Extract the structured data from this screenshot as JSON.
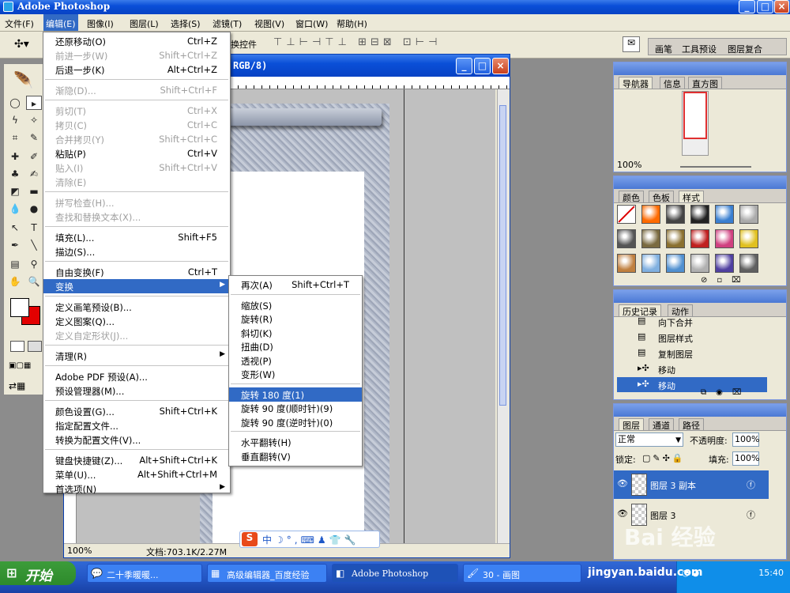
{
  "app": {
    "title": "Adobe Photoshop"
  },
  "menubar": [
    "文件(F)",
    "编辑(E)",
    "图像(I)",
    "图层(L)",
    "选择(S)",
    "滤镜(T)",
    "视图(V)",
    "窗口(W)",
    "帮助(H)"
  ],
  "toolbar": {
    "transform_controls": "换控件",
    "tabs": [
      "画笔",
      "工具预设",
      "图层复合"
    ]
  },
  "doc": {
    "title_suffix": "RGB/8)",
    "zoom": "100%",
    "status": "文档:703.1K/2.27M"
  },
  "edit_menu": [
    {
      "label": "还原移动(O)",
      "shortcut": "Ctrl+Z"
    },
    {
      "label": "前进一步(W)",
      "shortcut": "Shift+Ctrl+Z",
      "disabled": true
    },
    {
      "label": "后退一步(K)",
      "shortcut": "Alt+Ctrl+Z"
    },
    {
      "label": "渐隐(D)...",
      "shortcut": "Shift+Ctrl+F",
      "disabled": true
    },
    {
      "label": "剪切(T)",
      "shortcut": "Ctrl+X",
      "disabled": true
    },
    {
      "label": "拷贝(C)",
      "shortcut": "Ctrl+C",
      "disabled": true
    },
    {
      "label": "合并拷贝(Y)",
      "shortcut": "Shift+Ctrl+C",
      "disabled": true
    },
    {
      "label": "粘贴(P)",
      "shortcut": "Ctrl+V"
    },
    {
      "label": "贴入(I)",
      "shortcut": "Shift+Ctrl+V",
      "disabled": true
    },
    {
      "label": "清除(E)",
      "shortcut": "",
      "disabled": true
    },
    {
      "label": "拼写检查(H)...",
      "shortcut": "",
      "disabled": true
    },
    {
      "label": "查找和替换文本(X)...",
      "shortcut": "",
      "disabled": true
    },
    {
      "label": "填充(L)...",
      "shortcut": "Shift+F5"
    },
    {
      "label": "描边(S)...",
      "shortcut": ""
    },
    {
      "label": "自由变换(F)",
      "shortcut": "Ctrl+T"
    },
    {
      "label": "变换",
      "shortcut": "",
      "selected": true,
      "submenu": true
    },
    {
      "label": "定义画笔预设(B)...",
      "shortcut": ""
    },
    {
      "label": "定义图案(Q)...",
      "shortcut": ""
    },
    {
      "label": "定义自定形状(J)...",
      "shortcut": "",
      "disabled": true
    },
    {
      "label": "清理(R)",
      "shortcut": "",
      "submenu": true
    },
    {
      "label": "Adobe PDF 预设(A)...",
      "shortcut": ""
    },
    {
      "label": "预设管理器(M)...",
      "shortcut": ""
    },
    {
      "label": "颜色设置(G)...",
      "shortcut": "Shift+Ctrl+K"
    },
    {
      "label": "指定配置文件...",
      "shortcut": ""
    },
    {
      "label": "转换为配置文件(V)...",
      "shortcut": ""
    },
    {
      "label": "键盘快捷键(Z)...",
      "shortcut": "Alt+Shift+Ctrl+K"
    },
    {
      "label": "菜单(U)...",
      "shortcut": "Alt+Shift+Ctrl+M"
    },
    {
      "label": "首选项(N)",
      "shortcut": "",
      "submenu": true
    }
  ],
  "transform_menu": [
    {
      "label": "再次(A)",
      "shortcut": "Shift+Ctrl+T"
    },
    {
      "label": "缩放(S)"
    },
    {
      "label": "旋转(R)"
    },
    {
      "label": "斜切(K)"
    },
    {
      "label": "扭曲(D)"
    },
    {
      "label": "透视(P)"
    },
    {
      "label": "变形(W)"
    },
    {
      "label": "旋转 180 度(1)",
      "selected": true
    },
    {
      "label": "旋转 90 度(顺时针)(9)"
    },
    {
      "label": "旋转 90 度(逆时针)(0)"
    },
    {
      "label": "水平翻转(H)"
    },
    {
      "label": "垂直翻转(V)"
    }
  ],
  "navigator": {
    "tabs": [
      "导航器",
      "信息",
      "直方图"
    ],
    "zoom": "100%"
  },
  "styles": {
    "tabs": [
      "颜色",
      "色板",
      "样式"
    ],
    "swatches": [
      "#c23030",
      "#ff6a00",
      "#444444",
      "#222222",
      "#3a7fd0",
      "#aaaaaa",
      "#555555",
      "#7a6a40",
      "#8a7030",
      "#c02020",
      "#d04080",
      "#e0c020",
      "#c08040",
      "#80b0e0",
      "#5090d0",
      "#b0b0b0",
      "#5040a0",
      "#606060"
    ]
  },
  "history": {
    "tabs": [
      "历史记录",
      "动作"
    ],
    "items": [
      "向下合并",
      "图层样式",
      "复制图层",
      "移动",
      "移动"
    ]
  },
  "layers": {
    "tabs": [
      "图层",
      "通道",
      "路径"
    ],
    "blend_mode": "正常",
    "opacity_label": "不透明度:",
    "opacity": "100%",
    "lock_label": "锁定:",
    "fill_label": "填充:",
    "fill": "100%",
    "items": [
      "图层 3 副本",
      "图层 3"
    ]
  },
  "taskbar": {
    "start": "开始",
    "tasks": [
      "二十季暖暖...",
      "高级编辑器_百度经验",
      "Adobe Photoshop",
      "30 - 画图"
    ],
    "time": "15:40",
    "watermark": "Bai 经验",
    "watermark_url": "jingyan.baidu.com"
  }
}
